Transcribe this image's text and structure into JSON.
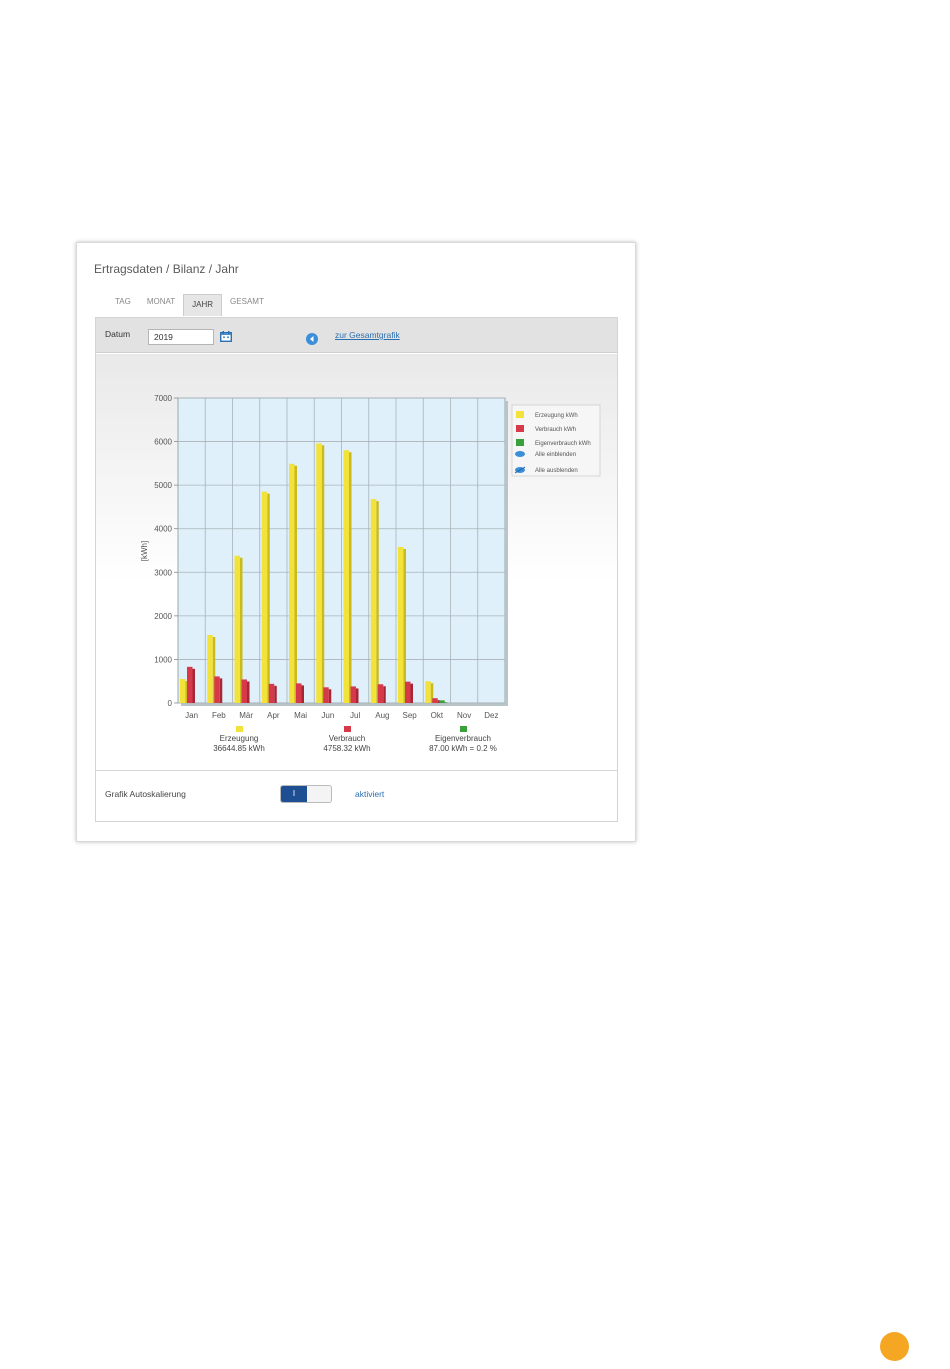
{
  "panel": {
    "title": "Ertragsdaten / Bilanz / Jahr"
  },
  "tabs": [
    {
      "label": "TAG",
      "active": false
    },
    {
      "label": "MONAT",
      "active": false
    },
    {
      "label": "JAHR",
      "active": true
    },
    {
      "label": "GESAMT",
      "active": false
    }
  ],
  "toolbar": {
    "datum_label": "Datum",
    "datum_value": "2019",
    "calendar_icon": "calendar-icon",
    "back_icon": "arrow-left-icon",
    "total_link": "zur Gesamtgrafik"
  },
  "legend_panel": {
    "items": [
      "Erzeugung kWh",
      "Verbrauch kWh",
      "Eigenverbrauch kWh"
    ],
    "show_all": "Alle einblenden",
    "hide_all": "Alle ausblenden"
  },
  "summary": [
    {
      "name": "Erzeugung",
      "value": "36644.85 kWh",
      "color": "#f2e23a"
    },
    {
      "name": "Verbrauch",
      "value": "4758.32 kWh",
      "color": "#d63a4a"
    },
    {
      "name": "Eigenverbrauch",
      "value": "87.00 kWh = 0.2 %",
      "color": "#3aa03a"
    }
  ],
  "autoscale": {
    "label": "Grafik Autoskalierung",
    "toggle_label": "I",
    "status": "aktiviert",
    "enabled": true
  },
  "colors": {
    "erzeugung": "#f2e23a",
    "verbrauch": "#d63a4a",
    "eigenverbrauch": "#3aa03a",
    "plot_bg": "#dff0fa",
    "accent": "#f5a623"
  },
  "chart_data": {
    "type": "bar",
    "categories": [
      "Jan",
      "Feb",
      "Mär",
      "Apr",
      "Mai",
      "Jun",
      "Jul",
      "Aug",
      "Sep",
      "Okt",
      "Nov",
      "Dez"
    ],
    "series": [
      {
        "name": "Erzeugung kWh",
        "values": [
          550,
          1560,
          3380,
          4850,
          5490,
          5960,
          5800,
          4680,
          3580,
          500,
          0,
          0
        ]
      },
      {
        "name": "Verbrauch kWh",
        "values": [
          830,
          610,
          540,
          440,
          450,
          360,
          380,
          430,
          490,
          110,
          0,
          0
        ]
      },
      {
        "name": "Eigenverbrauch kWh",
        "values": [
          0,
          0,
          0,
          0,
          0,
          0,
          0,
          0,
          0,
          60,
          0,
          0
        ]
      }
    ],
    "ylabel": "[kWh]",
    "ylim": [
      0,
      7000
    ],
    "yticks": [
      0,
      1000,
      2000,
      3000,
      4000,
      5000,
      6000,
      7000
    ],
    "grid": true,
    "legend_position": "right"
  }
}
